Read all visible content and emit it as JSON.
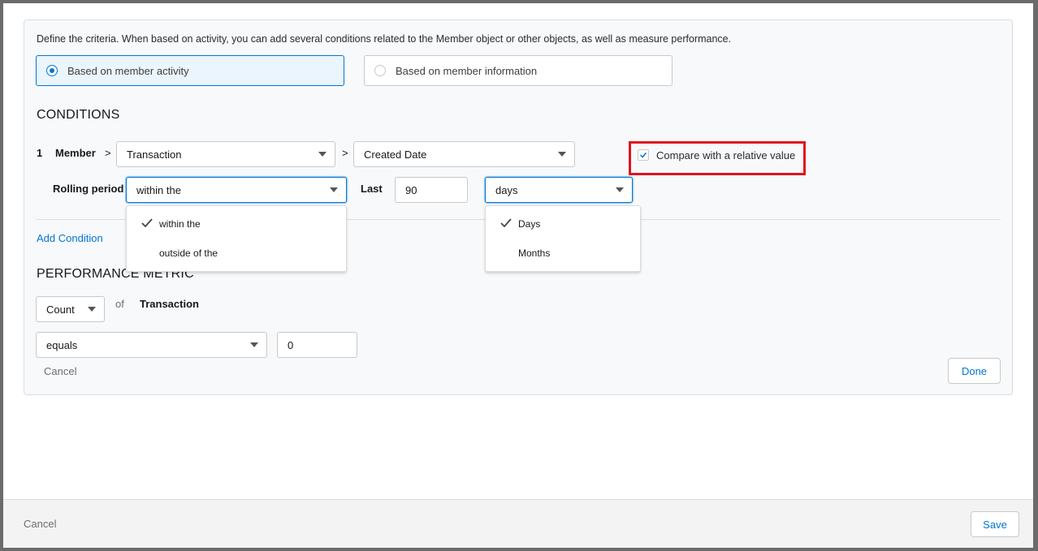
{
  "criteria": {
    "intro": "Define the criteria. When based on activity, you can add several conditions related to the Member object or other objects, as well as measure performance.",
    "options": [
      {
        "label": "Based on member activity",
        "selected": true
      },
      {
        "label": "Based on member information",
        "selected": false
      }
    ]
  },
  "conditions": {
    "title": "CONDITIONS",
    "number": "1",
    "object_label": "Member",
    "separator": ">",
    "object_select": "Transaction",
    "field_select": "Created Date",
    "relative_checkbox": {
      "label": "Compare with a relative value",
      "checked": true
    },
    "rolling_period_label": "Rolling period",
    "rolling_select": "within the",
    "last_label": "Last",
    "last_value": "90",
    "unit_select": "days",
    "rolling_options": [
      {
        "label": "within the",
        "checked": true
      },
      {
        "label": "outside of the",
        "checked": false
      }
    ],
    "unit_options": [
      {
        "label": "Days",
        "checked": true
      },
      {
        "label": "Months",
        "checked": false
      }
    ],
    "add_condition": "Add Condition"
  },
  "performance": {
    "title": "PERFORMANCE METRIC",
    "aggregate_select": "Count",
    "of_label": "of",
    "object": "Transaction",
    "operator_select": "equals",
    "value": "0",
    "cancel": "Cancel",
    "done": "Done"
  },
  "footer": {
    "cancel": "Cancel",
    "save": "Save"
  },
  "colors": {
    "accent": "#0176d3",
    "highlight": "#e0141e"
  }
}
